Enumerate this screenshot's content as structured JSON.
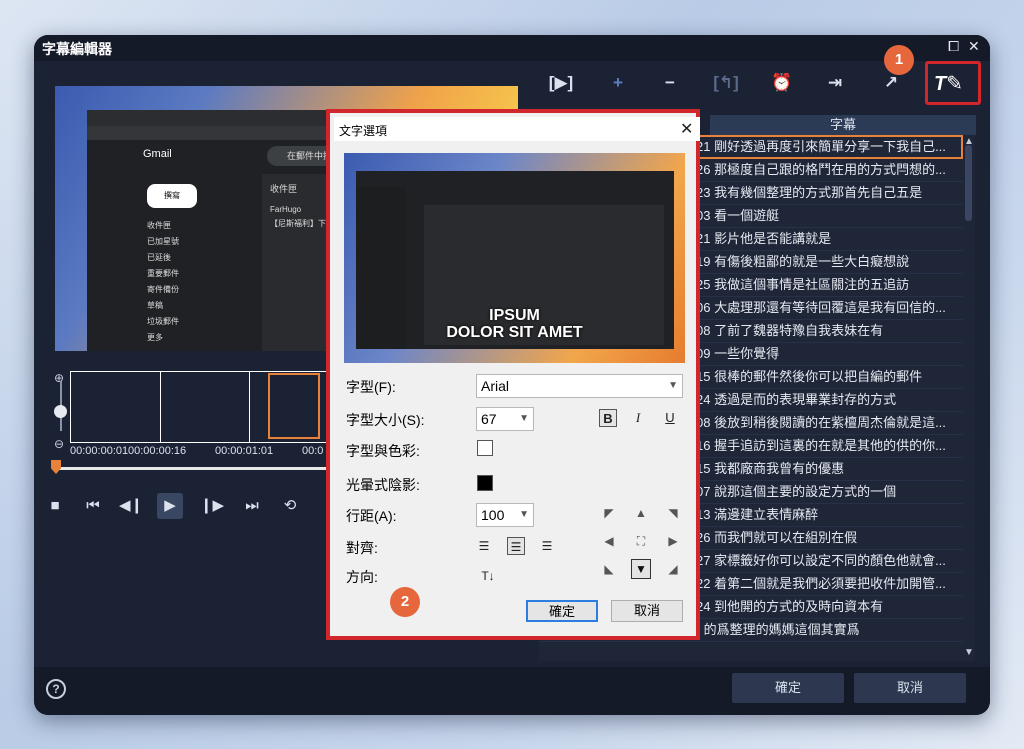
{
  "window": {
    "title": "字幕編輯器",
    "restore_glyph": "⧠",
    "close_glyph": "✕"
  },
  "preview_shot": {
    "gmail_label": "Gmail",
    "search_placeholder": "在郵件中搜尋",
    "compose_label": "撰寫",
    "nav": [
      "收件匣",
      "已加星號",
      "已延後",
      "重要郵件",
      "寄件備份",
      "草稿",
      "垃圾郵件",
      "更多"
    ],
    "panel_title": "收件匣",
    "panel_row1": "FarHugo",
    "panel_row2": "【尼斯福利】下一步驟"
  },
  "timeline": {
    "timecodes": [
      "00:00:00:01",
      "00:00:00:16",
      "00:00:01:01",
      "00:0"
    ]
  },
  "toolbar": {
    "icons": [
      "play-segment-icon",
      "add-icon",
      "remove-icon",
      "merge-icon",
      "alarm-icon",
      "import-icon",
      "export-icon",
      "text-style-icon"
    ]
  },
  "badges": {
    "one": "1",
    "two": "2"
  },
  "subtitles": {
    "header": "字幕",
    "rows": [
      {
        "text": "21 剛好透過再度引來簡單分享一下我自己..."
      },
      {
        "text": "26 那極度自己跟的格鬥在用的方式閂想的..."
      },
      {
        "text": "23 我有幾個整理的方式那首先自己五是"
      },
      {
        "text": "03 看一個遊艇"
      },
      {
        "text": "21 影片他是否能講就是"
      },
      {
        "text": "19 有傷後粗鄙的就是一些大白癡想說"
      },
      {
        "text": "25 我做這個事情是社區關注的五追訪"
      },
      {
        "text": "06 大處理那還有等待回覆這是我有回信的..."
      },
      {
        "text": "08 了前了魏器特豫自我表妹在有"
      },
      {
        "text": "09 一些你覺得"
      },
      {
        "text": "15 很棒的郵件然後你可以把自編的郵件"
      },
      {
        "text": "24 透過是而的表現畢業封存的方式"
      },
      {
        "text": "08 後放到稍後閱讀的在紫檀周杰倫就是這..."
      },
      {
        "text": "16 握手追訪到這裏的在就是其他的供的你..."
      },
      {
        "text": "15 我都廠商我曾有的優惠"
      },
      {
        "text": "07 說那這個主要的設定方式的一個"
      },
      {
        "text": "13 滿邊建立表情麻醉"
      },
      {
        "text": "26 而我們就可以在組別在假"
      },
      {
        "text": "27 家標籤好你可以設定不同的顏色他就會..."
      },
      {
        "text": "22 着第二個就是我們必須要把收件加開管..."
      },
      {
        "text": "24 到他開的方式的及時向資本有"
      },
      {
        "text": "22  00:01:16.26  00:01:18.21 的爲整理的媽媽這個其實爲"
      }
    ]
  },
  "bottom": {
    "help_glyph": "?",
    "ok": "確定",
    "cancel": "取消"
  },
  "dialog": {
    "title": "文字選項",
    "close_glyph": "✕",
    "preview_line1": "IPSUM",
    "preview_line2": "DOLOR SIT AMET",
    "font_label": "字型(F):",
    "font_value": "Arial",
    "size_label": "字型大小(S):",
    "size_value": "67",
    "color_label": "字型與色彩:",
    "color_value": "#ffffff",
    "shadow_label": "光暈式陰影:",
    "shadow_value": "#000000",
    "spacing_label": "行距(A):",
    "spacing_value": "100",
    "align_label": "對齊:",
    "direction_label": "方向:",
    "bold_glyph": "B",
    "italic_glyph": "I",
    "underline_glyph": "U",
    "direction_glyph": "T↓",
    "ok": "確定",
    "cancel": "取消"
  },
  "colors": {
    "accent_orange": "#e8813a",
    "highlight_red": "#d1262b",
    "badge": "#e5673b",
    "window_bg": "#1b2234"
  }
}
